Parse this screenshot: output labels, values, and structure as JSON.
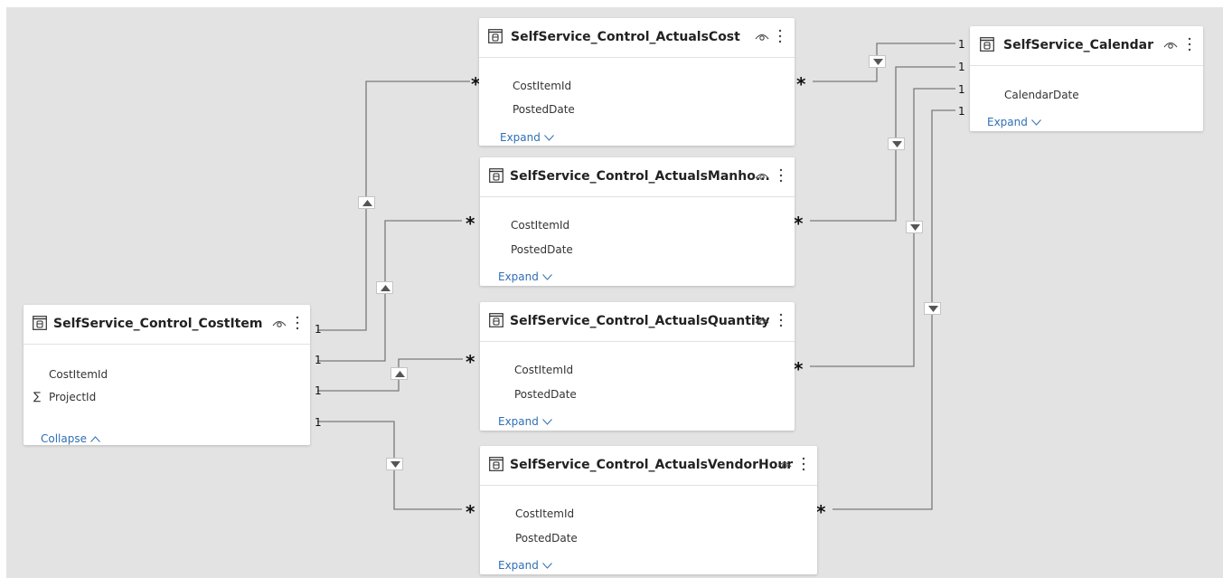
{
  "tables": {
    "costitem": {
      "title": "SelfService_Control_CostItem",
      "fields": [
        "CostItemId",
        "ProjectId"
      ],
      "toggle_label": "Collapse",
      "toggle_icon": "chevron-up-icon"
    },
    "actuals_cost": {
      "title": "SelfService_Control_ActualsCost",
      "fields": [
        "CostItemId",
        "PostedDate"
      ],
      "toggle_label": "Expand",
      "toggle_icon": "chevron-down-icon"
    },
    "actuals_manhours": {
      "title": "SelfService_Control_ActualsManho...",
      "fields": [
        "CostItemId",
        "PostedDate"
      ],
      "toggle_label": "Expand",
      "toggle_icon": "chevron-down-icon"
    },
    "actuals_quantity": {
      "title": "SelfService_Control_ActualsQuantity",
      "fields": [
        "CostItemId",
        "PostedDate"
      ],
      "toggle_label": "Expand",
      "toggle_icon": "chevron-down-icon"
    },
    "actuals_vendorhour": {
      "title": "SelfService_Control_ActualsVendorHour",
      "fields": [
        "CostItemId",
        "PostedDate"
      ],
      "toggle_label": "Expand",
      "toggle_icon": "chevron-down-icon"
    },
    "calendar": {
      "title": "SelfService_Calendar",
      "fields": [
        "CalendarDate"
      ],
      "toggle_label": "Expand",
      "toggle_icon": "chevron-down-icon"
    }
  },
  "cardinality": {
    "one": "1",
    "many": "*"
  },
  "colors": {
    "canvas": "#e3e3e3",
    "card": "#ffffff",
    "connector": "#7a7a7a",
    "link": "#2f6fb5"
  }
}
